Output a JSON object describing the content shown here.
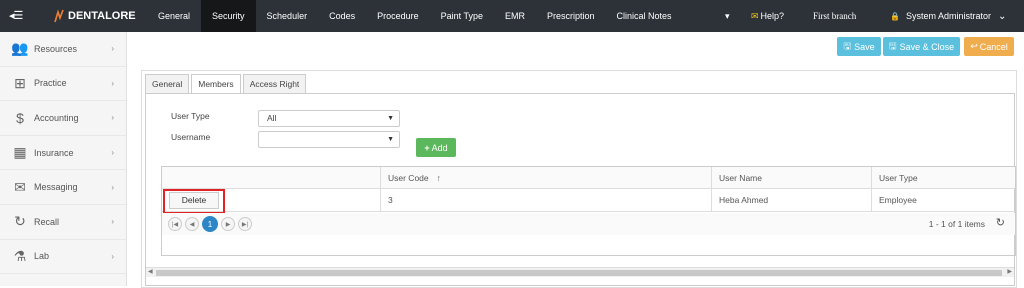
{
  "topbar": {
    "collapse_icon": "menu-collapse-icon",
    "logo_text": "DENTALORE",
    "nav": [
      "General",
      "Security",
      "Scheduler",
      "Codes",
      "Procedure",
      "Paint Type",
      "EMR",
      "Prescription",
      "Clinical Notes"
    ],
    "active_nav": "Security",
    "help": "Help?",
    "branch": "First branch",
    "user": "System Administrator"
  },
  "sidebar": {
    "items": [
      {
        "label": "Resources",
        "icon": "users-icon"
      },
      {
        "label": "Practice",
        "icon": "medkit-icon"
      },
      {
        "label": "Accounting",
        "icon": "dollar-icon"
      },
      {
        "label": "Insurance",
        "icon": "building-icon"
      },
      {
        "label": "Messaging",
        "icon": "envelope-icon"
      },
      {
        "label": "Recall",
        "icon": "refresh-icon"
      },
      {
        "label": "Lab",
        "icon": "flask-icon"
      }
    ]
  },
  "toolbar": {
    "save": "Save",
    "save_close": "Save & Close",
    "cancel": "Cancel"
  },
  "tabs": [
    "General",
    "Members",
    "Access Right"
  ],
  "active_tab": "Members",
  "form": {
    "user_type_label": "User Type",
    "user_type_value": "All",
    "username_label": "Username",
    "username_value": "",
    "add_label": "Add"
  },
  "grid": {
    "columns": [
      "",
      "User Code",
      "User Name",
      "User Type"
    ],
    "rows": [
      {
        "action": "Delete",
        "user_code": "3",
        "user_name": "Heba Ahmed",
        "user_type": "Employee"
      }
    ],
    "current_page": "1",
    "page_info": "1 - 1 of 1 items"
  },
  "colors": {
    "topbar": "#2d3239",
    "save": "#5bc0de",
    "cancel": "#f0ad4e",
    "add": "#5cb85c",
    "highlight": "#e32228",
    "page_active": "#2d87c7"
  }
}
